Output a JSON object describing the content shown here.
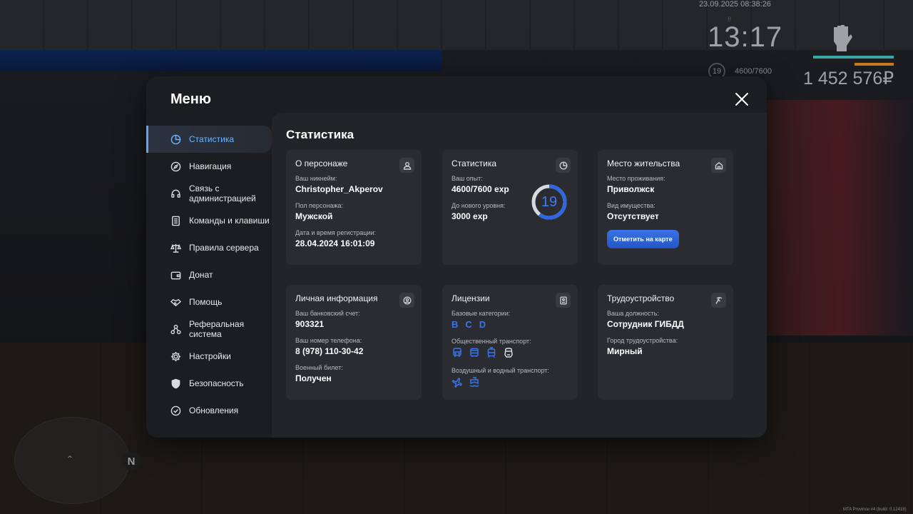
{
  "hud": {
    "date": "23.09.2025 08:38:26",
    "time": "13:17",
    "level": "19",
    "exp": "4600/7600",
    "money": "1 452 576₽",
    "marker": "!!",
    "build": "MTA Province #4 (build: 0.12418)"
  },
  "menu": {
    "title": "Меню",
    "close_icon": "close-icon"
  },
  "sidebar": {
    "items": [
      {
        "label": "Статистика",
        "icon": "pie-chart-icon",
        "active": true
      },
      {
        "label": "Навигация",
        "icon": "compass-icon"
      },
      {
        "label": "Связь с администрацией",
        "icon": "headset-icon"
      },
      {
        "label": "Команды и клавиши",
        "icon": "document-icon"
      },
      {
        "label": "Правила сервера",
        "icon": "scales-icon"
      },
      {
        "label": "Донат",
        "icon": "wallet-icon"
      },
      {
        "label": "Помощь",
        "icon": "handshake-icon"
      },
      {
        "label": "Реферальная система",
        "icon": "network-icon"
      },
      {
        "label": "Настройки",
        "icon": "gear-icon"
      },
      {
        "label": "Безопасность",
        "icon": "shield-icon"
      },
      {
        "label": "Обновления",
        "icon": "check-circle-icon"
      }
    ]
  },
  "content": {
    "title": "Статистика",
    "character": {
      "title": "О персонаже",
      "icon": "user-icon",
      "nickname_label": "Ваш никнейм:",
      "nickname": "Christopher_Akperov",
      "gender_label": "Пол персонажа:",
      "gender": "Мужской",
      "reg_label": "Дата и время регистрации:",
      "reg": "28.04.2024 16:01:09"
    },
    "stats": {
      "title": "Статистика",
      "icon": "pie-chart-icon",
      "exp_label": "Ваш опыт:",
      "exp": "4600/7600 exp",
      "next_label": "До нового уровня:",
      "next": "3000 exp",
      "level": "19",
      "progress": 0.605
    },
    "residence": {
      "title": "Место жительства",
      "icon": "home-icon",
      "place_label": "Место проживания:",
      "place": "Приволжск",
      "property_label": "Вид имущества:",
      "property": "Отсутствует",
      "button": "Отметить на карте"
    },
    "personal": {
      "title": "Личная информация",
      "icon": "user-circle-icon",
      "bank_label": "Ваш банковский счет:",
      "bank": "903321",
      "phone_label": "Ваш номер телефона:",
      "phone": "8 (978) 110-30-42",
      "military_label": "Военный билет:",
      "military": "Получен"
    },
    "licenses": {
      "title": "Лицензии",
      "icon": "id-card-icon",
      "base_label": "Базовые категории:",
      "categories": [
        "B",
        "C",
        "D"
      ],
      "public_label": "Общественный транспорт:",
      "public_icons": [
        "bus-icon",
        "bus-icon",
        "tram-icon",
        "metro-icon"
      ],
      "air_label": "Воздушный и водный транспорт:",
      "air_icons": [
        "plane-icon",
        "ship-icon"
      ]
    },
    "employment": {
      "title": "Трудоустройство",
      "icon": "pickaxe-icon",
      "position_label": "Ваша должность:",
      "position": "Сотрудник ГИБДД",
      "city_label": "Город трудоустройства:",
      "city": "Мирный"
    }
  }
}
